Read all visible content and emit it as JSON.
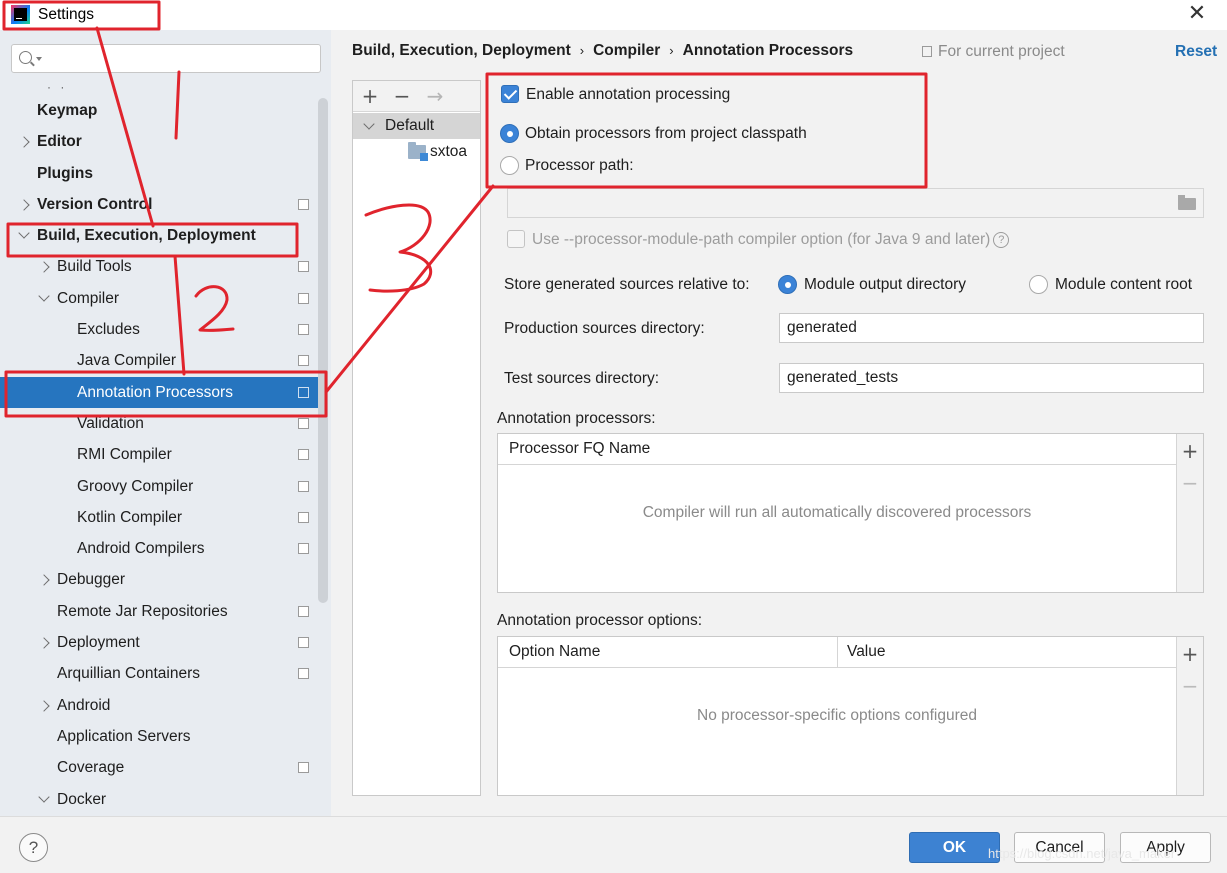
{
  "window": {
    "title": "Settings",
    "close_glyph": "✕"
  },
  "search": {
    "placeholder": "",
    "value": ""
  },
  "tree_top_ellipsis": "· ·",
  "tree": [
    {
      "label": "Keymap",
      "bold": true,
      "indent": 0,
      "arrow": "none",
      "proj": false
    },
    {
      "label": "Editor",
      "bold": true,
      "indent": 0,
      "arrow": "right",
      "proj": false
    },
    {
      "label": "Plugins",
      "bold": true,
      "indent": 0,
      "arrow": "none",
      "proj": false
    },
    {
      "label": "Version Control",
      "bold": true,
      "indent": 0,
      "arrow": "right",
      "proj": true
    },
    {
      "label": "Build, Execution, Deployment",
      "bold": true,
      "indent": 0,
      "arrow": "down",
      "proj": false
    },
    {
      "label": "Build Tools",
      "bold": false,
      "indent": 1,
      "arrow": "right",
      "proj": true
    },
    {
      "label": "Compiler",
      "bold": false,
      "indent": 1,
      "arrow": "down",
      "proj": true
    },
    {
      "label": "Excludes",
      "bold": false,
      "indent": 2,
      "arrow": "none",
      "proj": true
    },
    {
      "label": "Java Compiler",
      "bold": false,
      "indent": 2,
      "arrow": "none",
      "proj": true
    },
    {
      "label": "Annotation Processors",
      "bold": false,
      "indent": 2,
      "arrow": "none",
      "proj": true,
      "selected": true
    },
    {
      "label": "Validation",
      "bold": false,
      "indent": 2,
      "arrow": "none",
      "proj": true
    },
    {
      "label": "RMI Compiler",
      "bold": false,
      "indent": 2,
      "arrow": "none",
      "proj": true
    },
    {
      "label": "Groovy Compiler",
      "bold": false,
      "indent": 2,
      "arrow": "none",
      "proj": true
    },
    {
      "label": "Kotlin Compiler",
      "bold": false,
      "indent": 2,
      "arrow": "none",
      "proj": true
    },
    {
      "label": "Android Compilers",
      "bold": false,
      "indent": 2,
      "arrow": "none",
      "proj": true
    },
    {
      "label": "Debugger",
      "bold": false,
      "indent": 1,
      "arrow": "right",
      "proj": false
    },
    {
      "label": "Remote Jar Repositories",
      "bold": false,
      "indent": 1,
      "arrow": "none",
      "proj": true
    },
    {
      "label": "Deployment",
      "bold": false,
      "indent": 1,
      "arrow": "right",
      "proj": true
    },
    {
      "label": "Arquillian Containers",
      "bold": false,
      "indent": 1,
      "arrow": "none",
      "proj": true
    },
    {
      "label": "Android",
      "bold": false,
      "indent": 1,
      "arrow": "right",
      "proj": false
    },
    {
      "label": "Application Servers",
      "bold": false,
      "indent": 1,
      "arrow": "none",
      "proj": false
    },
    {
      "label": "Coverage",
      "bold": false,
      "indent": 1,
      "arrow": "none",
      "proj": true
    },
    {
      "label": "Docker",
      "bold": false,
      "indent": 1,
      "arrow": "down",
      "proj": false
    }
  ],
  "breadcrumb": {
    "items": [
      "Build, Execution, Deployment",
      "Compiler",
      "Annotation Processors"
    ],
    "separator": "›",
    "scope": "For current project",
    "reset": "Reset"
  },
  "profiles": {
    "toolbar": {
      "add": "+",
      "remove": "−",
      "move": "→"
    },
    "default": "Default",
    "module": "sxtoa"
  },
  "settings": {
    "enable_label": "Enable annotation processing",
    "enable_checked": true,
    "obtain_label": "Obtain processors from project classpath",
    "processor_path_label": "Processor path:",
    "processor_path_value": "",
    "module_path_label": "Use --processor-module-path compiler option (for Java 9 and later)",
    "store_label": "Store generated sources relative to:",
    "store_option_output": "Module output directory",
    "store_option_content": "Module content root",
    "prod_label": "Production sources directory:",
    "prod_value": "generated",
    "test_label": "Test sources directory:",
    "test_value": "generated_tests"
  },
  "processors_table": {
    "title": "Annotation processors:",
    "column": "Processor FQ Name",
    "empty": "Compiler will run all automatically discovered processors"
  },
  "options_table": {
    "title": "Annotation processor options:",
    "columns": [
      "Option Name",
      "Value"
    ],
    "empty": "No processor-specific options configured"
  },
  "footer": {
    "help": "?",
    "ok": "OK",
    "cancel": "Cancel",
    "apply": "Apply",
    "watermark": "https://blog.csdn.net/java_maker"
  },
  "annotations": {
    "color": "#e0242d",
    "numbers": [
      "1",
      "2",
      "3"
    ]
  }
}
